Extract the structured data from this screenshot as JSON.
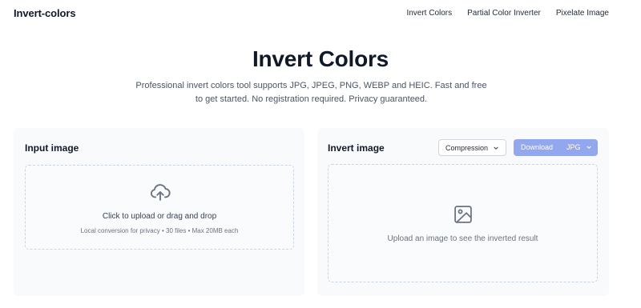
{
  "header": {
    "logo": "Invert-colors",
    "nav": [
      {
        "label": "Invert Colors"
      },
      {
        "label": "Partial Color Inverter"
      },
      {
        "label": "Pixelate Image"
      }
    ]
  },
  "hero": {
    "title": "Invert Colors",
    "subtitle": "Professional invert colors tool supports JPG, JPEG, PNG, WEBP and HEIC. Fast and free to get started. No registration required. Privacy guaranteed."
  },
  "input_panel": {
    "title": "Input image",
    "upload_icon": "cloud-upload-icon",
    "upload_text": "Click to upload or drag and drop",
    "upload_hint": "Local conversion for privacy • 30 files • Max 20MB each"
  },
  "output_panel": {
    "title": "Invert image",
    "compression_label": "Compression",
    "download_label": "Download",
    "format_label": "JPG",
    "placeholder_icon": "image-icon",
    "placeholder_text": "Upload an image to see the inverted result"
  },
  "colors": {
    "download_button": "#93a7ee",
    "panel_bg": "#f9fafb",
    "dropzone_border": "#cbd5e1"
  }
}
